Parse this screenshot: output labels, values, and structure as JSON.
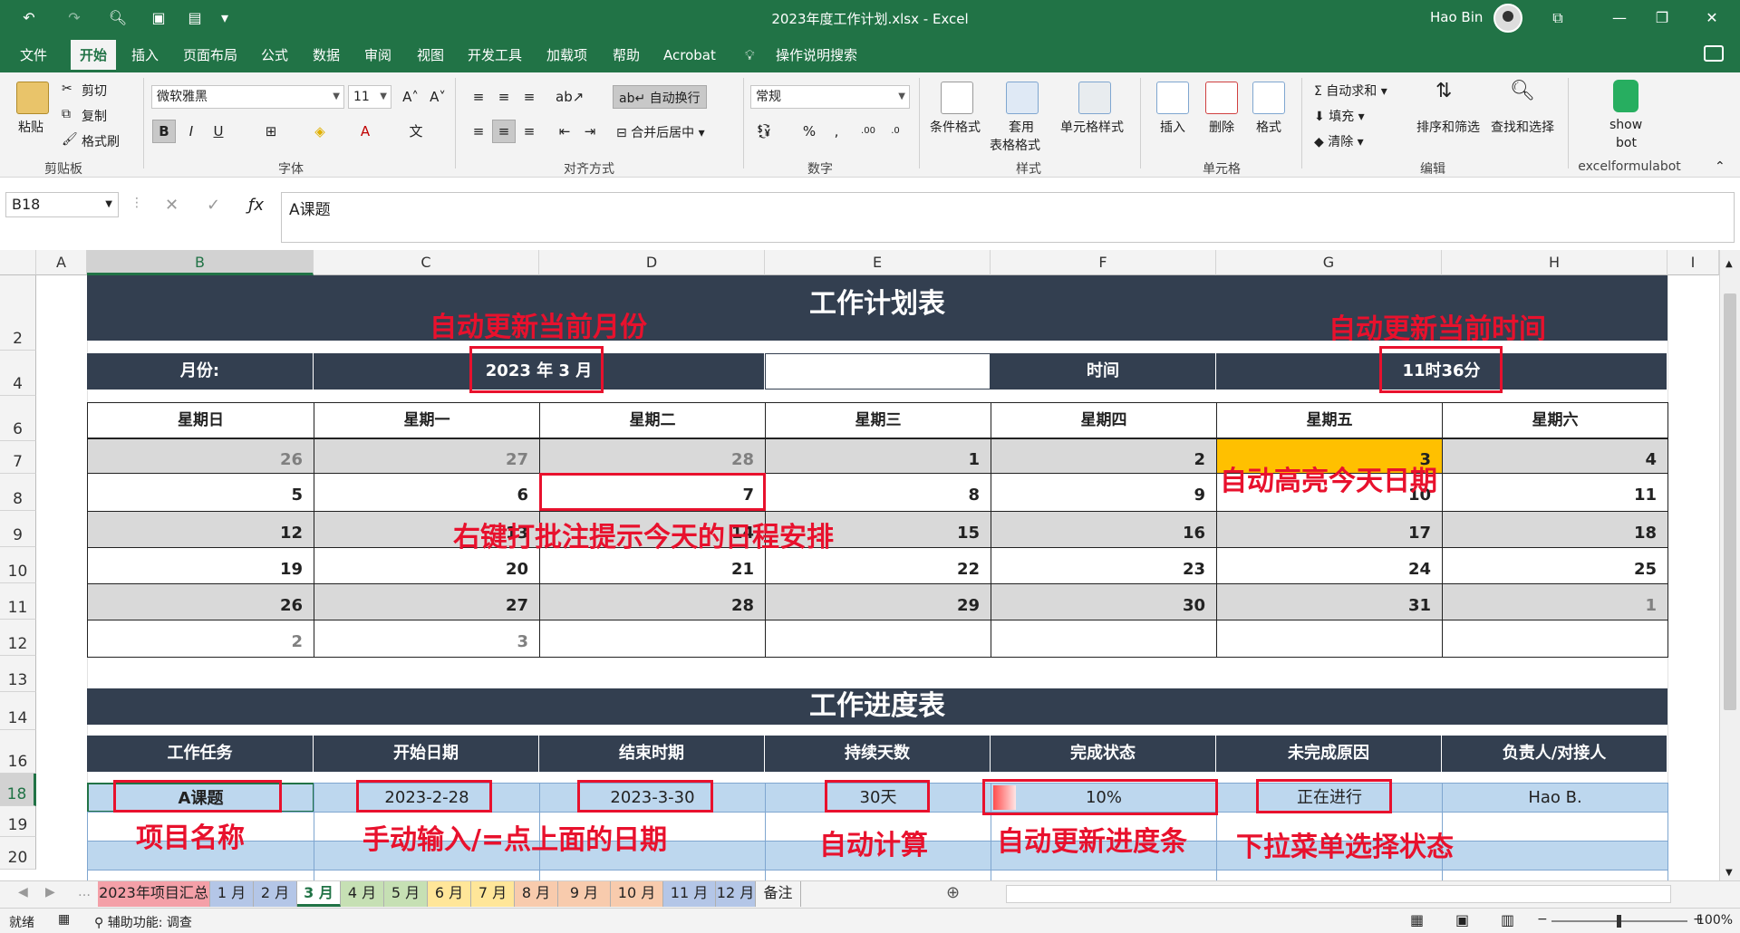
{
  "window": {
    "title": "2023年度工作计划.xlsx  -  Excel",
    "user": "Hao Bin"
  },
  "tabs": [
    "文件",
    "开始",
    "插入",
    "页面布局",
    "公式",
    "数据",
    "审阅",
    "视图",
    "开发工具",
    "加载项",
    "帮助",
    "Acrobat"
  ],
  "tell_me": "操作说明搜索",
  "ribbon": {
    "clipboard": {
      "paste": "粘贴",
      "cut": "剪切",
      "copy": "复制",
      "format_painter": "格式刷",
      "group": "剪贴板"
    },
    "font": {
      "name": "微软雅黑",
      "size": "11",
      "group": "字体"
    },
    "alignment": {
      "wrap": "自动换行",
      "merge": "合并后居中",
      "group": "对齐方式"
    },
    "number": {
      "format": "常规",
      "group": "数字"
    },
    "styles": {
      "conditional": "条件格式",
      "table_1": "套用",
      "table_2": "表格格式",
      "cell_styles": "单元格样式",
      "group": "样式"
    },
    "cells": {
      "insert": "插入",
      "delete": "删除",
      "format": "格式",
      "group": "单元格"
    },
    "editing": {
      "autosum": "自动求和",
      "fill": "填充",
      "clear": "清除",
      "sort": "排序和筛选",
      "find": "查找和选择",
      "group": "编辑"
    },
    "addin": {
      "show_1": "show",
      "show_2": "bot",
      "group": "excelformulabot"
    }
  },
  "formula_bar": {
    "name_box": "B18",
    "content": "A课题"
  },
  "columns": [
    "A",
    "B",
    "C",
    "D",
    "E",
    "F",
    "G",
    "H",
    "I"
  ],
  "rows": [
    "2",
    "4",
    "6",
    "7",
    "8",
    "9",
    "10",
    "11",
    "12",
    "13",
    "14",
    "16",
    "18",
    "19",
    "20"
  ],
  "sheet": {
    "plan_title": "工作计划表",
    "month_label": "月份:",
    "month_value": "2023 年 3 月",
    "time_label": "时间",
    "time_value": "11时36分",
    "weekdays": [
      "星期日",
      "星期一",
      "星期二",
      "星期三",
      "星期四",
      "星期五",
      "星期六"
    ],
    "calendar": [
      [
        "26",
        "27",
        "28",
        "1",
        "2",
        "3",
        "4"
      ],
      [
        "5",
        "6",
        "7",
        "8",
        "9",
        "10",
        "11"
      ],
      [
        "12",
        "13",
        "14",
        "15",
        "16",
        "17",
        "18"
      ],
      [
        "19",
        "20",
        "21",
        "22",
        "23",
        "24",
        "25"
      ],
      [
        "26",
        "27",
        "28",
        "29",
        "30",
        "31",
        "1"
      ],
      [
        "2",
        "3",
        "",
        "",
        "",
        "",
        ""
      ]
    ],
    "progress_title": "工作进度表",
    "progress_headers": [
      "工作任务",
      "开始日期",
      "结束时期",
      "持续天数",
      "完成状态",
      "未完成原因",
      "负责人/对接人"
    ],
    "progress_row": [
      "A课题",
      "2023-2-28",
      "2023-3-30",
      "30天",
      "10%",
      "正在进行",
      "Hao B."
    ],
    "progress_fill": 0.1
  },
  "annotations": {
    "auto_month": "自动更新当前月份",
    "auto_time": "自动更新当前时间",
    "highlight_today": "自动高亮今天日期",
    "comment_schedule": "右键打批注提示今天的日程安排",
    "project_name": "项目名称",
    "manual_input": "手动输入/=点上面的日期",
    "auto_calc": "自动计算",
    "auto_progress": "自动更新进度条",
    "dropdown_status": "下拉菜单选择状态"
  },
  "sheet_tabs": [
    "2023年项目汇总",
    "1 月",
    "2 月",
    "3 月",
    "4 月",
    "5 月",
    "6 月",
    "7 月",
    "8 月",
    "9 月",
    "10 月",
    "11 月",
    "12 月",
    "备注"
  ],
  "sheet_tab_colors": [
    "#f4a0a8",
    "#b4c6e7",
    "#b4c6e7",
    "#ffffff",
    "#c6e0b4",
    "#c6e0b4",
    "#ffe699",
    "#ffe699",
    "#f8cbad",
    "#f8cbad",
    "#f8cbad",
    "#b4c6e7",
    "#b4c6e7",
    "#f3f3f3"
  ],
  "status": {
    "ready": "就绪",
    "accessibility": "辅助功能: 调查",
    "zoom": "100%"
  },
  "colors": {
    "excel_green": "#217346",
    "header_dark": "#333f50",
    "today": "#ffc000",
    "annotation": "#e8112d"
  }
}
